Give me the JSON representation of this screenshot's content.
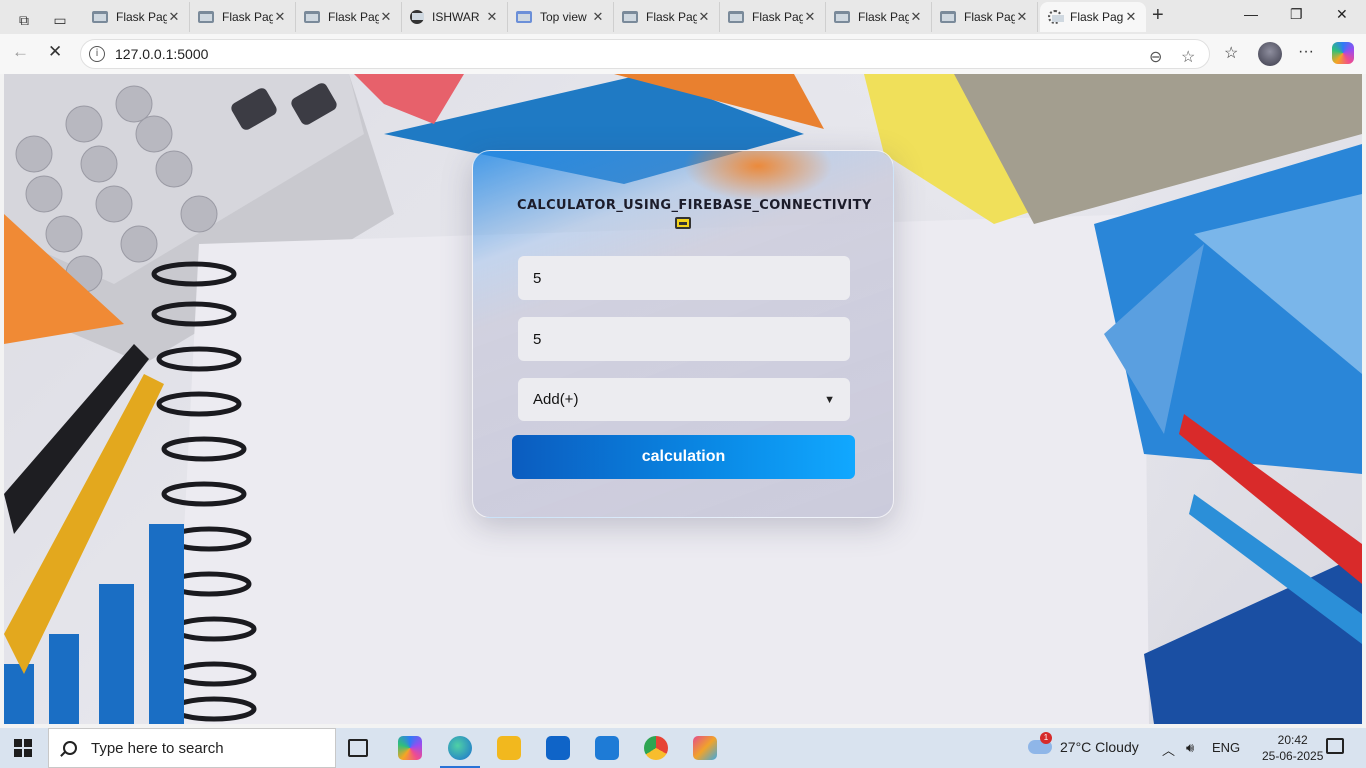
{
  "browser": {
    "tabs": [
      {
        "label": "Flask Pag",
        "favicon": "page-icon"
      },
      {
        "label": "Flask Pag",
        "favicon": "page-icon"
      },
      {
        "label": "Flask Pag",
        "favicon": "page-icon"
      },
      {
        "label": "ISHWAR",
        "favicon": "github-icon"
      },
      {
        "label": "Top view",
        "favicon": "doc-icon"
      },
      {
        "label": "Flask Pag",
        "favicon": "page-icon"
      },
      {
        "label": "Flask Pag",
        "favicon": "page-icon"
      },
      {
        "label": "Flask Pag",
        "favicon": "page-icon"
      },
      {
        "label": "Flask Pag",
        "favicon": "page-icon"
      },
      {
        "label": "Flask Pag",
        "favicon": "loading-icon",
        "active": true
      }
    ],
    "url": "127.0.0.1:5000"
  },
  "calculator": {
    "title": "CALCULATOR_USING_FIREBASE_CONNECTIVITY",
    "first_number": "5",
    "second_number": "5",
    "operation": "Add(+)",
    "button_label": "calculation"
  },
  "taskbar": {
    "search_placeholder": "Type here to search",
    "weather": "27°C  Cloudy",
    "weather_badge": "1",
    "language": "ENG",
    "time": "20:42",
    "date": "25-06-2025"
  },
  "colors": {
    "button_start": "#0b5cbf",
    "button_end": "#11a8ff",
    "taskbar": "#d9e3ef"
  }
}
